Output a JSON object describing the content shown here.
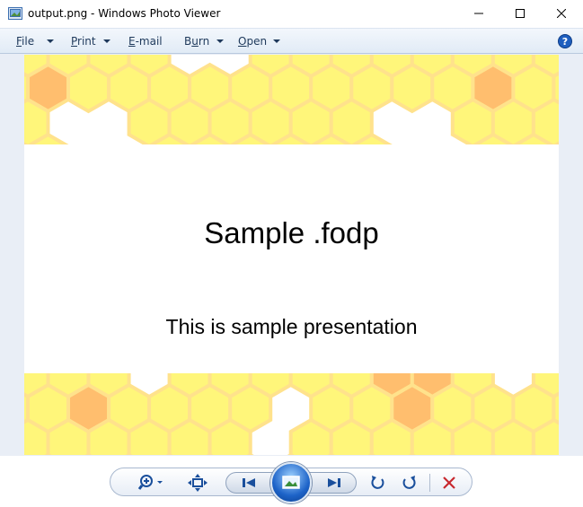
{
  "window": {
    "title": "output.png - Windows Photo Viewer"
  },
  "menu": {
    "file": {
      "accel": "F",
      "rest": "ile"
    },
    "print": {
      "accel": "P",
      "rest": "rint"
    },
    "email": {
      "accel": "E",
      "rest": "-mail"
    },
    "burn": {
      "pre": "B",
      "accel": "u",
      "rest": "rn"
    },
    "open": {
      "accel": "O",
      "rest": "pen"
    }
  },
  "slide": {
    "title": "Sample .fodp",
    "subtitle": "This is sample presentation"
  },
  "colors": {
    "hex_light": "#fff67a",
    "hex_border": "#ffe28c",
    "hex_orange": "#ffbe6e",
    "accent": "#1e395b"
  },
  "toolbar": {
    "icons": [
      "zoom-icon",
      "actual-size-icon",
      "previous-icon",
      "slideshow-icon",
      "next-icon",
      "rotate-counterclockwise-icon",
      "rotate-clockwise-icon",
      "delete-icon"
    ]
  }
}
